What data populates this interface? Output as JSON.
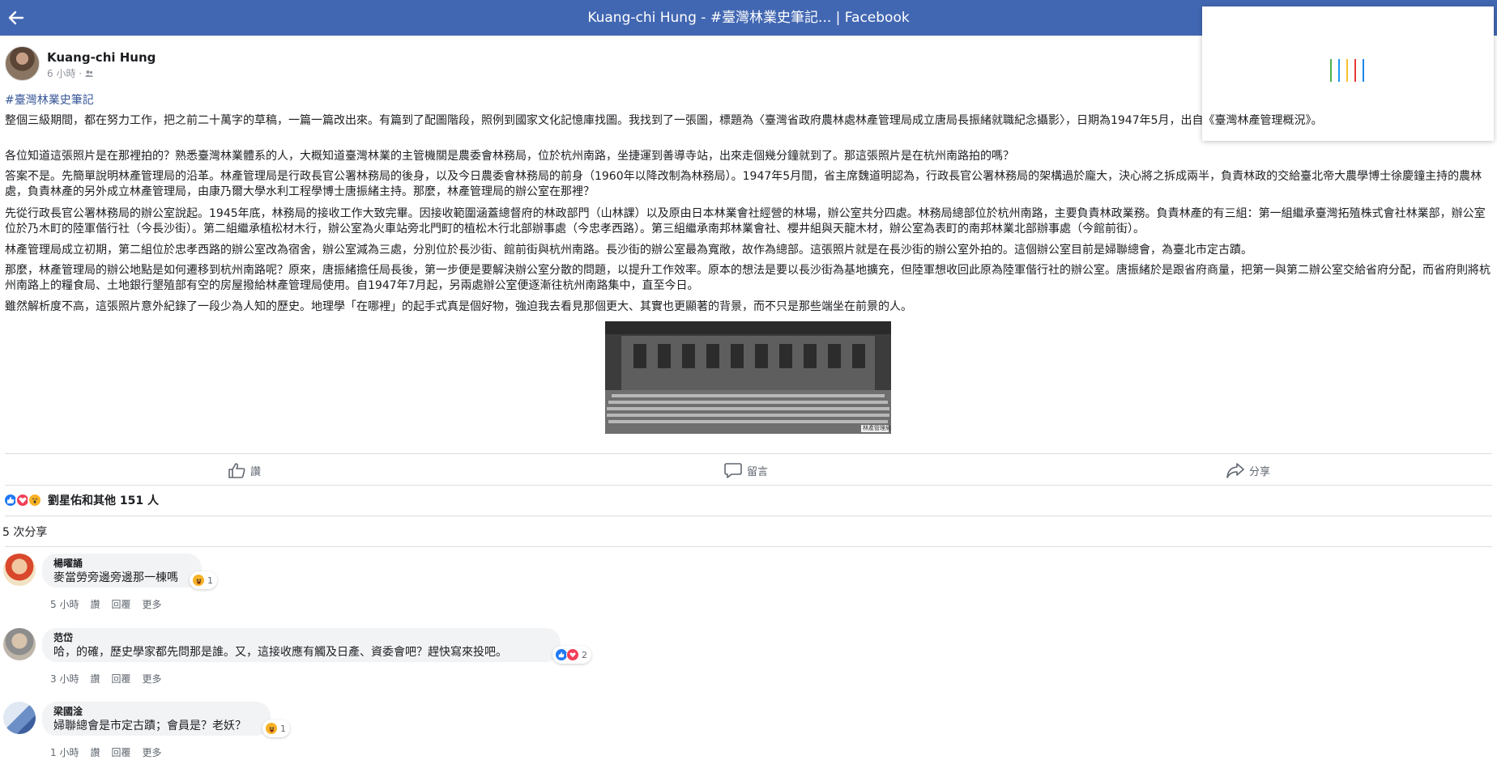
{
  "topbar": {
    "title": "Kuang-chi Hung - #臺灣林業史筆記... | Facebook"
  },
  "loader": {
    "colors": [
      "#4caf50",
      "#2196f3",
      "#fbc02d",
      "#e53935",
      "#1e88e5"
    ]
  },
  "post": {
    "author": "Kuang-chi Hung",
    "meta": "6 小時 · ",
    "hashtag": "#臺灣林業史筆記",
    "paragraphs": [
      "整個三級期間，都在努力工作，把之前二十萬字的草稿，一篇一篇改出來。有篇到了配圖階段，照例到國家文化記憶庫找圖。我找到了一張圖，標題為〈臺灣省政府農林處林產管理局成立唐局長振緒就職紀念攝影〉，日期為1947年5月，出自《臺灣林產管理概況》。",
      "各位知道這張照片是在那裡拍的？熟悉臺灣林業體系的人，大概知道臺灣林業的主管機關是農委會林務局，位於杭州南路，坐捷運到善導寺站，出來走個幾分鐘就到了。那這張照片是在杭州南路拍的嗎？",
      "答案不是。先簡單說明林產管理局的沿革。林產管理局是行政長官公署林務局的後身，以及今日農委會林務局的前身（1960年以降改制為林務局）。1947年5月間，省主席魏道明認為，行政長官公署林務局的架構過於龐大，決心將之拆成兩半，負責林政的交給臺北帝大農學博士徐慶鐘主持的農林處，負責林產的另外成立林產管理局，由康乃爾大學水利工程學博士唐振緒主持。那麼，林產管理局的辦公室在那裡？",
      "先從行政長官公署林務局的辦公室說起。1945年底，林務局的接收工作大致完畢。因接收範圍涵蓋總督府的林政部門（山林課）以及原由日本林業會社經營的林場，辦公室共分四處。林務局總部位於杭州南路，主要負責林政業務。負責林產的有三組：第一組繼承臺灣拓殖株式會社林業部，辦公室位於乃木町的陸軍偕行社（今長沙街）。第二組繼承植松材木行，辦公室為火車站旁北門町的植松木行北部辦事處（今忠孝西路）。第三組繼承南邦林業會社、櫻井組與天龍木材，辦公室為表町的南邦林業北部辦事處（今館前街）。",
      "林產管理局成立初期，第二組位於忠孝西路的辦公室改為宿舍，辦公室減為三處，分別位於長沙街、館前街與杭州南路。長沙街的辦公室最為寬敞，故作為總部。這張照片就是在長沙街的辦公室外拍的。這個辦公室目前是婦聯總會，為臺北市定古蹟。",
      "那麼，林產管理局的辦公地點是如何遷移到杭州南路呢？原來，唐振緒擔任局長後，第一步便是要解決辦公室分散的問題，以提升工作效率。原本的想法是要以長沙街為基地擴充，但陸軍想收回此原為陸軍偕行社的辦公室。唐振緒於是跟省府商量，把第一與第二辦公室交給省府分配，而省府則將杭州南路上的糧食局、土地銀行墾殖部有空的房屋撥給林產管理局使用。自1947年7月起，另兩處辦公室便逐漸往杭州南路集中，直至今日。",
      "雖然解析度不高，這張照片意外紀錄了一段少為人知的歷史。地理學「在哪裡」的起手式真是個好物，強迫我去看見那個更大、其實也更顯著的背景，而不只是那些端坐在前景的人。"
    ],
    "photo_caption": "林產管理局成立紀念",
    "actions": {
      "like": "讚",
      "comment": "留言",
      "share": "分享"
    },
    "reactions_summary": "劉星佑和其他 151 人",
    "shares_text": "5 次分享"
  },
  "comments": [
    {
      "name": "楊曜誦",
      "text": "麥當勞旁邊旁邊那一棟嗎",
      "reaction_count": "1",
      "reaction_icons": [
        "haha-icon"
      ],
      "time": "5 小時",
      "like": "讚",
      "reply": "回覆",
      "more": "更多"
    },
    {
      "name": "范岱",
      "text": "哈，的確，歷史學家都先問那是誰。又，這接收應有觸及日產、資委會吧？趕快寫來投吧。",
      "reaction_count": "2",
      "reaction_icons": [
        "like-icon",
        "love-icon"
      ],
      "time": "3 小時",
      "like": "讚",
      "reply": "回覆",
      "more": "更多"
    },
    {
      "name": "梁國淦",
      "text": "婦聯總會是市定古蹟；會員是？老妖？",
      "reaction_count": "1",
      "reaction_icons": [
        "haha-icon"
      ],
      "time": "1 小時",
      "like": "讚",
      "reply": "回覆",
      "more": "更多"
    }
  ],
  "colors": {
    "brand": "#4267b2",
    "link": "#385898",
    "like": "#2078f4",
    "love": "#f33e58",
    "wow": "#f7b125"
  }
}
